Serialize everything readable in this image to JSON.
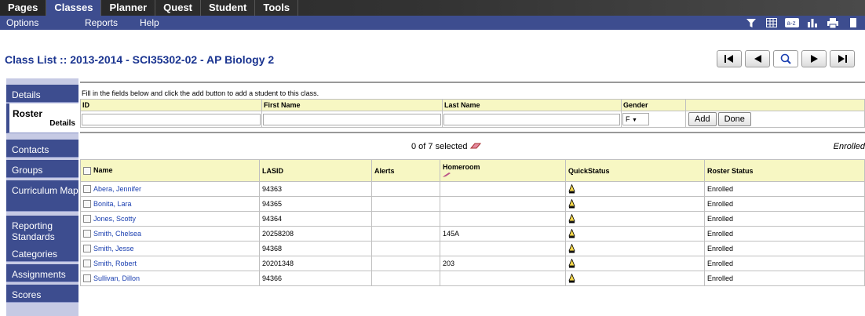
{
  "top_tabs": [
    "Pages",
    "Classes",
    "Planner",
    "Quest",
    "Student",
    "Tools"
  ],
  "sub_menu": [
    "Options",
    "Reports",
    "Help"
  ],
  "title": "Class List :: 2013-2014 - SCI35302-02 - AP Biology 2",
  "sidebar": [
    {
      "label": "Details"
    },
    {
      "label": "Roster",
      "sub": "Details"
    },
    {
      "label": "Contacts"
    },
    {
      "label": "Groups"
    },
    {
      "label": "Curriculum Map"
    },
    {
      "label": "Reporting Standards"
    },
    {
      "label": "Categories"
    },
    {
      "label": "Assignments"
    },
    {
      "label": "Scores"
    }
  ],
  "add_form": {
    "instruction": "Fill in the fields below and click the add button to add a student to this class.",
    "headers": [
      "ID",
      "First Name",
      "Last Name",
      "Gender"
    ],
    "gender_value": "F",
    "add_label": "Add",
    "done_label": "Done"
  },
  "selection": "0 of 7 selected",
  "enrolled_label": "Enrolled",
  "roster": {
    "headers": [
      "Name",
      "LASID",
      "Alerts",
      "Homeroom",
      "QuickStatus",
      "Roster Status"
    ],
    "rows": [
      {
        "name": "Abera, Jennifer",
        "lasid": "94363",
        "homeroom": "",
        "status": "Enrolled"
      },
      {
        "name": "Bonita, Lara",
        "lasid": "94365",
        "homeroom": "",
        "status": "Enrolled"
      },
      {
        "name": "Jones, Scotty",
        "lasid": "94364",
        "homeroom": "",
        "status": "Enrolled"
      },
      {
        "name": "Smith, Chelsea",
        "lasid": "20258208",
        "homeroom": "145A",
        "status": "Enrolled"
      },
      {
        "name": "Smith, Jesse",
        "lasid": "94368",
        "homeroom": "",
        "status": "Enrolled"
      },
      {
        "name": "Smith, Robert",
        "lasid": "20201348",
        "homeroom": "203",
        "status": "Enrolled"
      },
      {
        "name": "Sullivan, Dillon",
        "lasid": "94366",
        "homeroom": "",
        "status": "Enrolled"
      }
    ]
  },
  "icons": {
    "toolbar": [
      "filter-icon",
      "grid-icon",
      "sort-az-icon",
      "chart-icon",
      "print-icon",
      "export-icon"
    ]
  }
}
